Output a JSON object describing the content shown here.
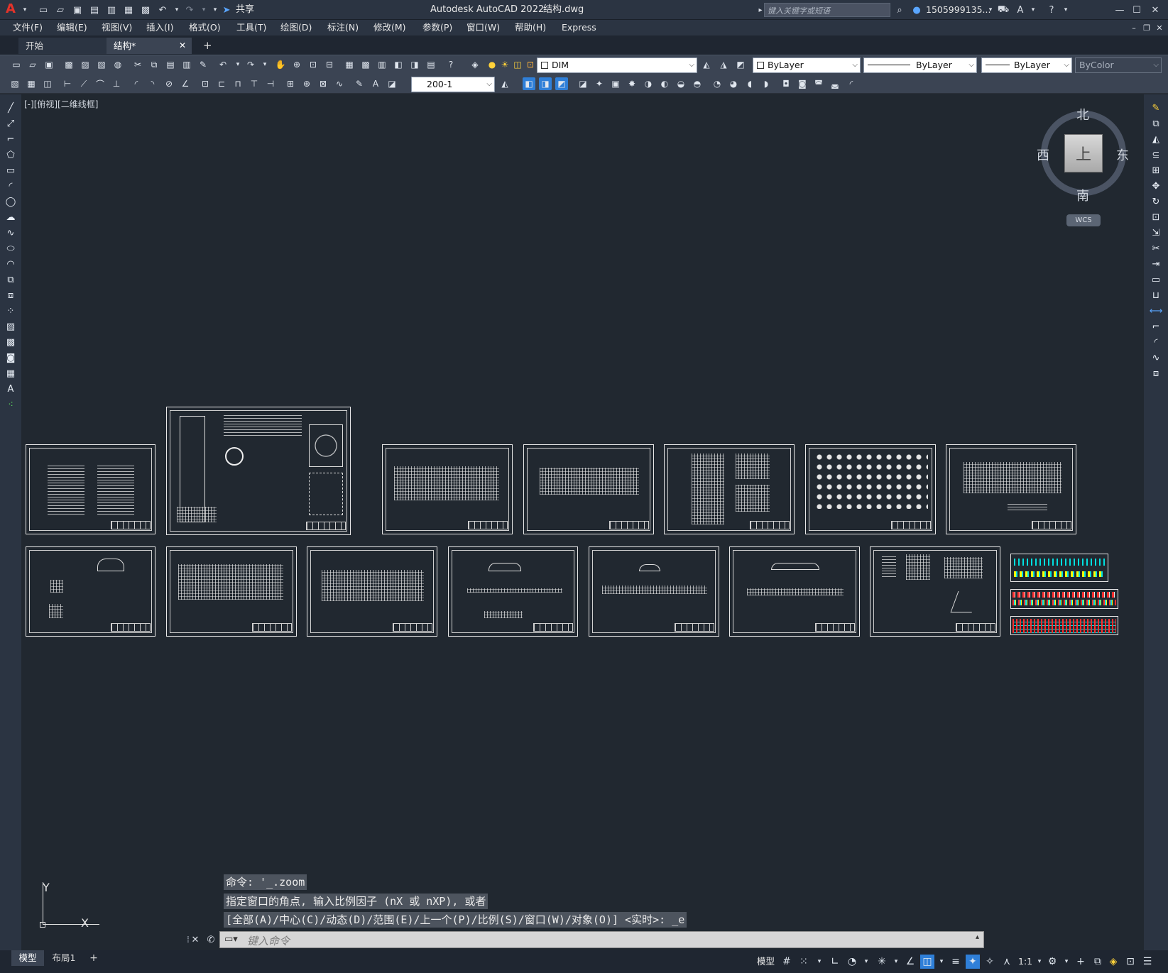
{
  "app": {
    "title": "Autodesk AutoCAD 2022",
    "file": "结构.dwg",
    "share_label": "共享",
    "search_placeholder": "键入关键字或短语",
    "user": "1505999135...",
    "logo": "A"
  },
  "menu": [
    "文件(F)",
    "编辑(E)",
    "视图(V)",
    "插入(I)",
    "格式(O)",
    "工具(T)",
    "绘图(D)",
    "标注(N)",
    "修改(M)",
    "参数(P)",
    "窗口(W)",
    "帮助(H)",
    "Express"
  ],
  "tabs": [
    {
      "label": "开始"
    },
    {
      "label": "结构*",
      "close": "✕"
    }
  ],
  "tab_add": "+",
  "toolbar1": {
    "layer": "DIM",
    "color": "ByLayer",
    "linetype": "ByLayer",
    "lineweight": "ByLayer",
    "plotstyle": "ByColor"
  },
  "toolbar2": {
    "dimstyle": "200-1"
  },
  "viewport": {
    "label": "[-][俯视][二维线框]"
  },
  "viewcube": {
    "north": "北",
    "south": "南",
    "east": "东",
    "west": "西",
    "top": "上",
    "wcs": "WCS"
  },
  "ucs": {
    "x": "X",
    "y": "Y"
  },
  "command": {
    "history": [
      "命令: '_.zoom",
      "指定窗口的角点, 输入比例因子 (nX 或 nXP), 或者",
      "[全部(A)/中心(C)/动态(D)/范围(E)/上一个(P)/比例(S)/窗口(W)/对象(O)] <实时>: _e"
    ],
    "placeholder": "键入命令"
  },
  "layout_tabs": [
    "模型",
    "布局1"
  ],
  "layout_add": "+",
  "status": {
    "model": "模型",
    "scale": "1:1"
  },
  "colors": {
    "canvas": "#212830",
    "chrome": "#2b3442",
    "toolbar": "#3b4453",
    "accent": "#2f7fd8"
  }
}
